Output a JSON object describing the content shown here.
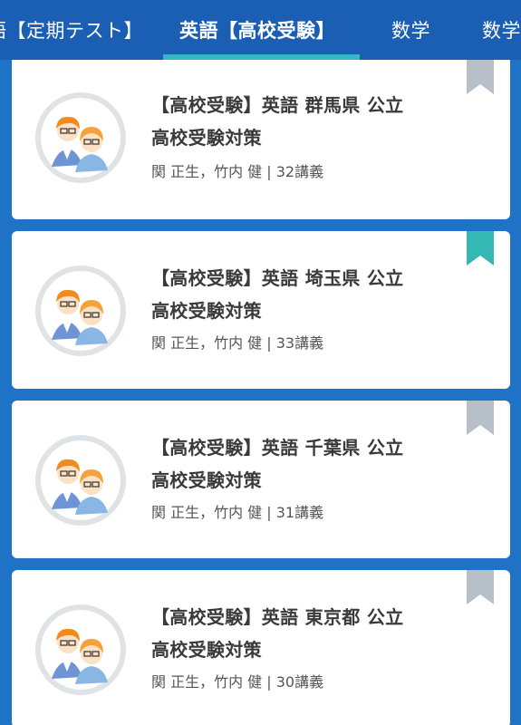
{
  "tabs": [
    {
      "label": "語【定期テスト】",
      "active": false
    },
    {
      "label": "英語【高校受験】",
      "active": true
    },
    {
      "label": "数学",
      "active": false
    },
    {
      "label": "数学",
      "active": false
    }
  ],
  "colors": {
    "tab_bar": "#1a5fb4",
    "tab_indicator": "#35b6c9",
    "page_background": "#1f73c6",
    "bookmark_off": "#b7bfc8",
    "bookmark_on": "#35b8b4"
  },
  "courses": [
    {
      "title_line1": "【高校受験】英語 群馬県 公立",
      "title_line2": "高校受験対策",
      "meta": "関 正生，竹内 健 | 32講義",
      "bookmarked": false
    },
    {
      "title_line1": "【高校受験】英語 埼玉県 公立",
      "title_line2": "高校受験対策",
      "meta": "関 正生，竹内 健 | 33講義",
      "bookmarked": true
    },
    {
      "title_line1": "【高校受験】英語 千葉県 公立",
      "title_line2": "高校受験対策",
      "meta": "関 正生，竹内 健 | 31講義",
      "bookmarked": false
    },
    {
      "title_line1": "【高校受験】英語 東京都 公立",
      "title_line2": "高校受験対策",
      "meta": "関 正生，竹内 健 | 30講義",
      "bookmarked": false
    }
  ]
}
